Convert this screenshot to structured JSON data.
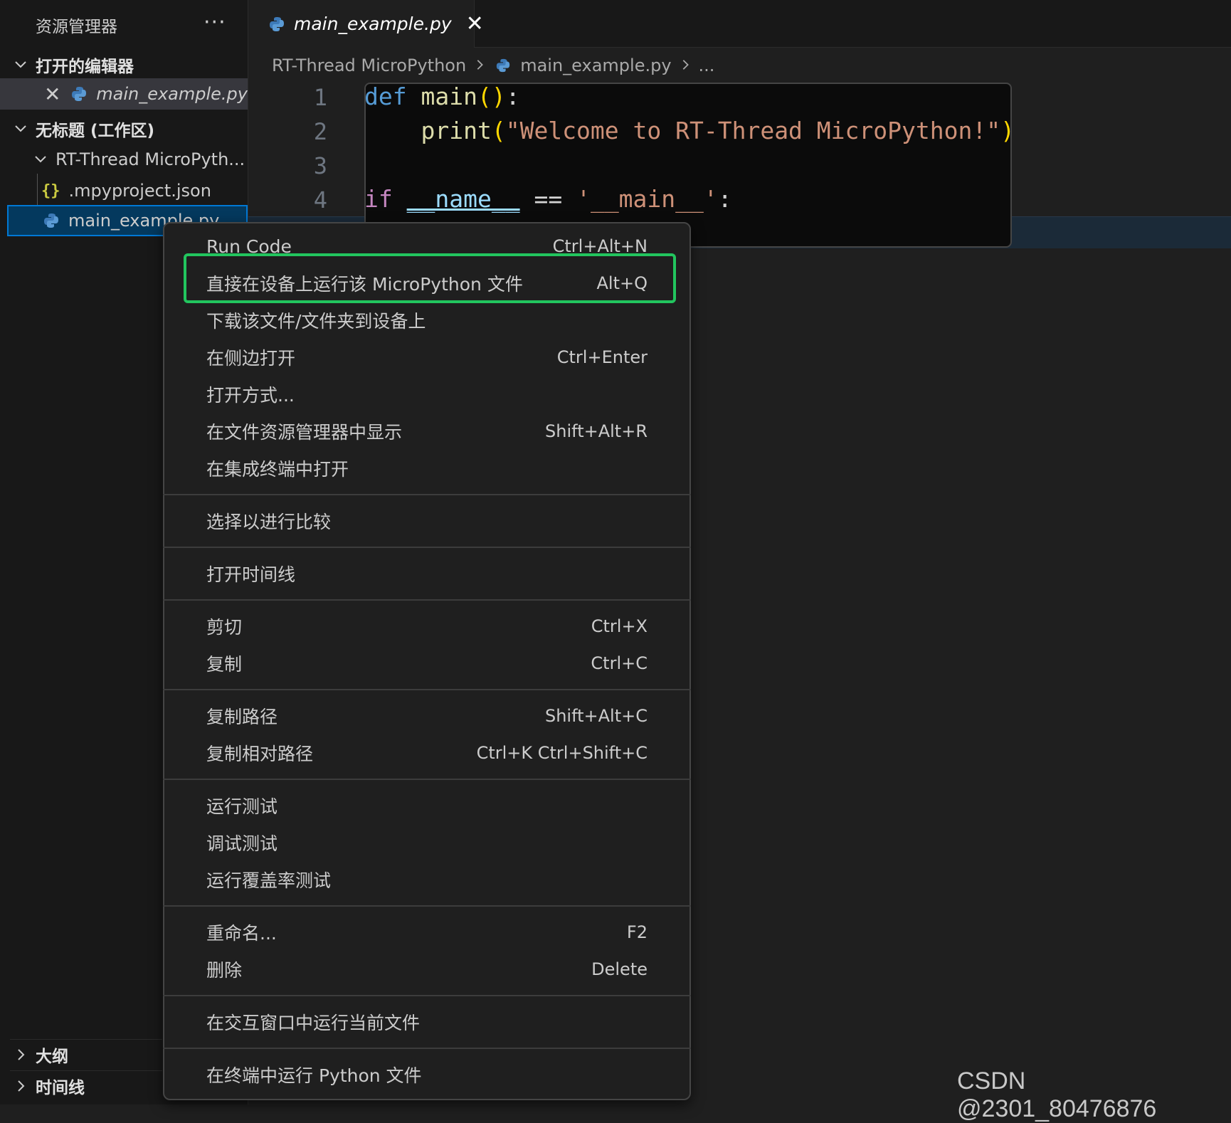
{
  "sidebar": {
    "title": "资源管理器",
    "more_icon": "···",
    "open_editors": {
      "label": "打开的编辑器",
      "file": "main_example.py"
    },
    "workspace": {
      "label": "无标题 (工作区)",
      "folder": "RT-Thread MicroPyth...",
      "files": [
        ".mpyproject.json",
        "main_example.py"
      ]
    },
    "outline_label": "大纲",
    "timeline_label": "时间线"
  },
  "tab": {
    "label": "main_example.py"
  },
  "breadcrumb": {
    "folder": "RT-Thread MicroPython",
    "file": "main_example.py",
    "more": "..."
  },
  "editor": {
    "line_numbers": [
      "1",
      "2",
      "3",
      "4"
    ],
    "tokens": {
      "def": "def",
      "main": "main",
      "paren_open": "(",
      "paren_close": ")",
      "colon": ":",
      "print": "print",
      "string": "\"Welcome to RT-Thread MicroPython!\"",
      "if": "if",
      "name": "__name__",
      "eq": "==",
      "main_str": "'__main__'"
    }
  },
  "context_menu": {
    "items": [
      {
        "label": "Run Code",
        "shortcut": "Ctrl+Alt+N"
      },
      {
        "label": "直接在设备上运行该 MicroPython 文件",
        "shortcut": "Alt+Q"
      },
      {
        "label": "下载该文件/文件夹到设备上",
        "shortcut": ""
      },
      {
        "label": "在侧边打开",
        "shortcut": "Ctrl+Enter"
      },
      {
        "label": "打开方式...",
        "shortcut": ""
      },
      {
        "label": "在文件资源管理器中显示",
        "shortcut": "Shift+Alt+R"
      },
      {
        "label": "在集成终端中打开",
        "shortcut": ""
      },
      {
        "label": "选择以进行比较",
        "shortcut": ""
      },
      {
        "label": "打开时间线",
        "shortcut": ""
      },
      {
        "label": "剪切",
        "shortcut": "Ctrl+X"
      },
      {
        "label": "复制",
        "shortcut": "Ctrl+C"
      },
      {
        "label": "复制路径",
        "shortcut": "Shift+Alt+C"
      },
      {
        "label": "复制相对路径",
        "shortcut": "Ctrl+K Ctrl+Shift+C"
      },
      {
        "label": "运行测试",
        "shortcut": ""
      },
      {
        "label": "调试测试",
        "shortcut": ""
      },
      {
        "label": "运行覆盖率测试",
        "shortcut": ""
      },
      {
        "label": "重命名...",
        "shortcut": "F2"
      },
      {
        "label": "删除",
        "shortcut": "Delete"
      },
      {
        "label": "在交互窗口中运行当前文件",
        "shortcut": ""
      },
      {
        "label": "在终端中运行 Python 文件",
        "shortcut": ""
      }
    ]
  },
  "watermark": "CSDN @2301_80476876",
  "colors": {
    "highlight": "#22c55e",
    "selection": "#04395e",
    "accent": "#0078d4"
  }
}
